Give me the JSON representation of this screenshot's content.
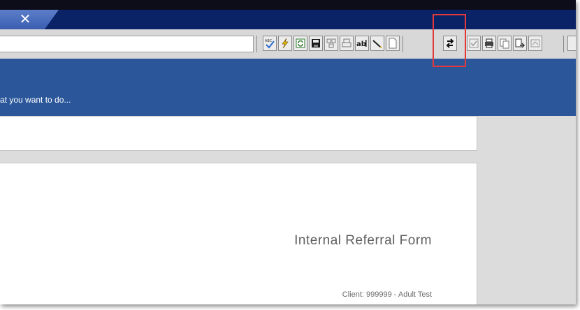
{
  "window": {
    "close_glyph": "✕"
  },
  "toolbar": {
    "buttons": [
      {
        "name": "spellcheck-icon"
      },
      {
        "name": "lightning-icon"
      },
      {
        "name": "refresh-icon"
      },
      {
        "name": "save-disk-icon"
      },
      {
        "name": "network-icon"
      },
      {
        "name": "printer-lock-icon"
      },
      {
        "name": "text-field-icon"
      },
      {
        "name": "pen-icon"
      },
      {
        "name": "document-icon"
      },
      {
        "name": "swap-arrows-icon"
      },
      {
        "name": "checklist-icon"
      },
      {
        "name": "print-icon"
      },
      {
        "name": "copy-icon"
      },
      {
        "name": "export-icon"
      },
      {
        "name": "sign-icon"
      }
    ]
  },
  "ribbon": {
    "tell_me": "at you want to do..."
  },
  "document": {
    "form_title": "Internal Referral Form",
    "client_line": "Client:  999999  -  Adult Test"
  },
  "colors": {
    "ribbon": "#2b579a",
    "titlebar": "#0a2266",
    "highlight": "#e23a3a"
  }
}
